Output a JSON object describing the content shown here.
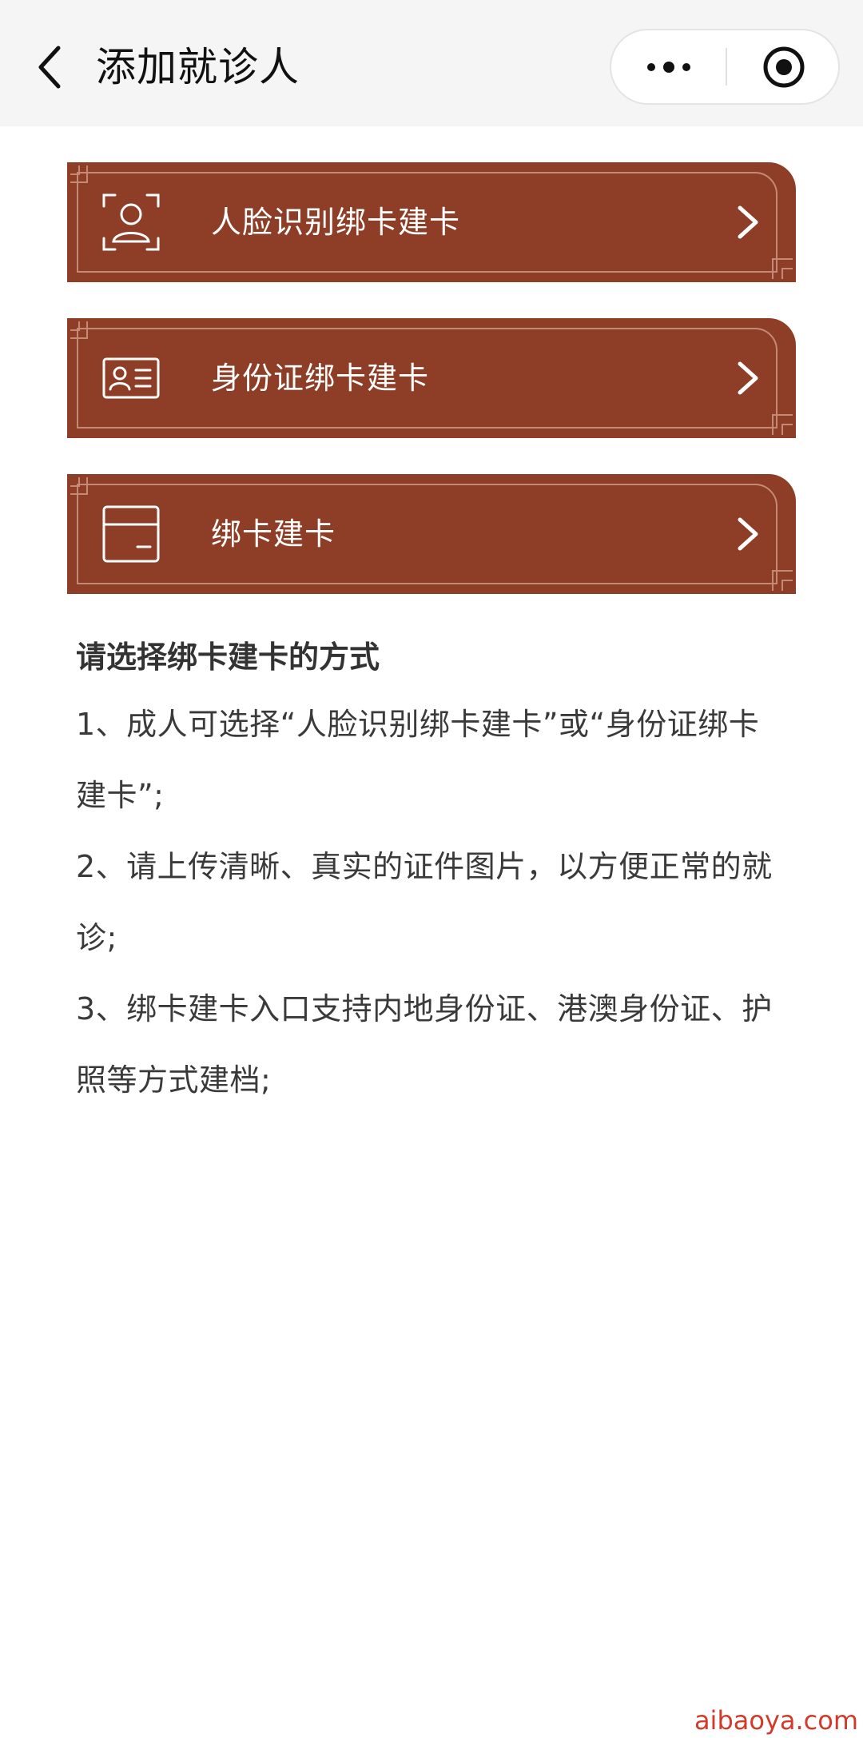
{
  "header": {
    "title": "添加就诊人"
  },
  "options": [
    {
      "label": "人脸识别绑卡建卡",
      "icon": "face-scan-icon"
    },
    {
      "label": "身份证绑卡建卡",
      "icon": "id-card-icon"
    },
    {
      "label": "绑卡建卡",
      "icon": "bank-card-icon"
    }
  ],
  "info": {
    "heading": "请选择绑卡建卡的方式",
    "items": [
      "1、成人可选择“人脸识别绑卡建卡”或“身份证绑卡建卡”;",
      "2、请上传清晰、真实的证件图片，以方便正常的就诊;",
      "3、绑卡建卡入口支持内地身份证、港澳身份证、护照等方式建档;"
    ]
  },
  "watermark": "aibaoya.com",
  "colors": {
    "card_background": "#8e3d26",
    "card_border": "#c48a76",
    "nav_background": "#f5f5f5",
    "watermark": "#d23a2a"
  }
}
